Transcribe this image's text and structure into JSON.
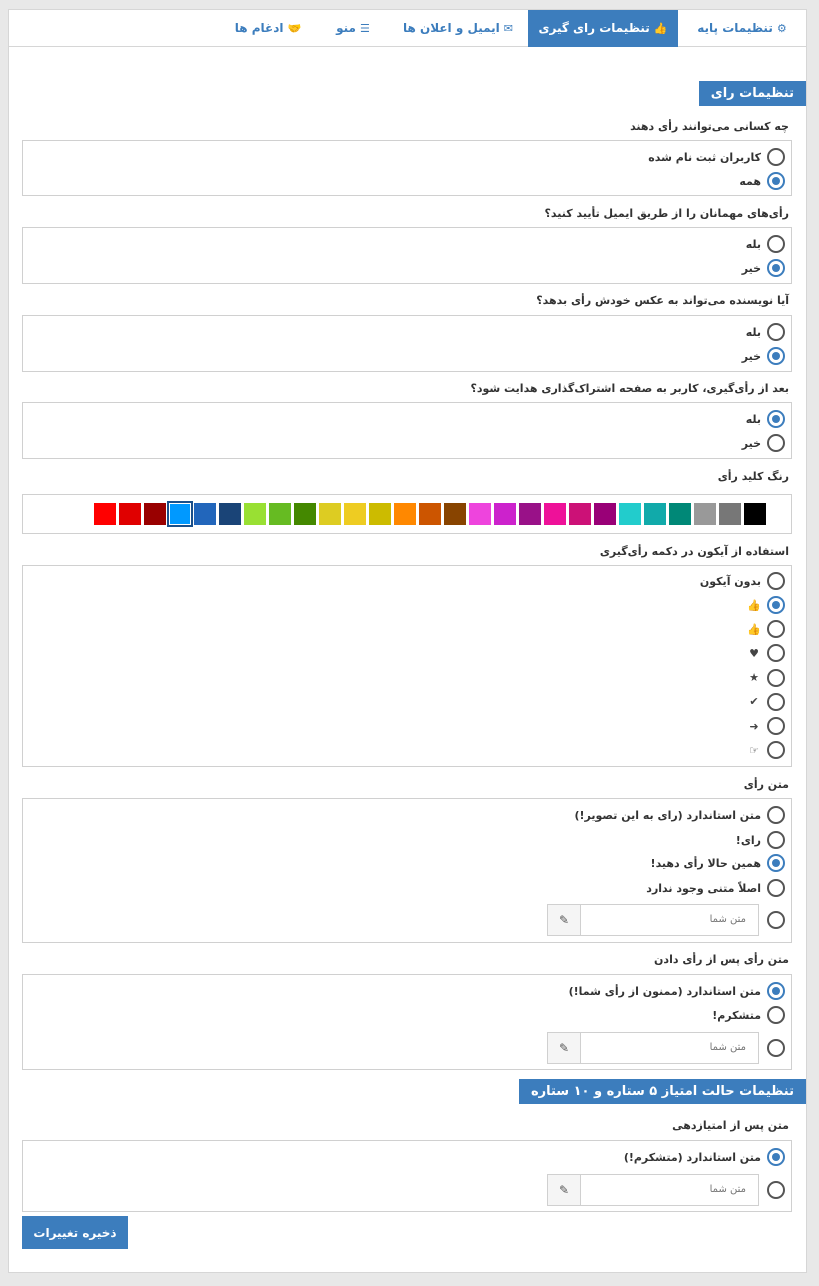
{
  "tabs": [
    {
      "label": "تنظیمات پایه",
      "icon": "gears-icon",
      "glyph": "⚙"
    },
    {
      "label": "تنظیمات رای گیری",
      "icon": "thumbs-up-icon",
      "glyph": "👍"
    },
    {
      "label": "ایمیل و اعلان ها",
      "icon": "envelope-icon",
      "glyph": "✉"
    },
    {
      "label": "منو",
      "icon": "bars-icon",
      "glyph": "☰"
    },
    {
      "label": "ادغام ها",
      "icon": "handshake-icon",
      "glyph": "🤝"
    }
  ],
  "section1": {
    "title": "تنظیمات رای"
  },
  "q_who": {
    "label": "چه کسانی می‌توانند رأی دهند",
    "options": [
      "کاربران ثبت نام شده",
      "همه"
    ]
  },
  "q_guest": {
    "label": "رأی‌های مهمانان را از طریق ایمیل تأیید کنید؟",
    "options": [
      "بله",
      "خیر"
    ]
  },
  "q_author": {
    "label": "آیا نویسنده می‌تواند به عکس خودش رأی بدهد؟",
    "options": [
      "بله",
      "خیر"
    ]
  },
  "q_redirect": {
    "label": "بعد از رأی‌گیری، کاربر به صفحه اشتراک‌گذاری هدایت شود؟",
    "options": [
      "بله",
      "خیر"
    ]
  },
  "q_color": {
    "label": "رنگ کلید رأی",
    "colors": [
      "#ff0000",
      "#e00000",
      "#990000",
      "#0099ff",
      "#2266bb",
      "#1a4477",
      "#99e033",
      "#66bb22",
      "#448800",
      "#ddcc22",
      "#eecc22",
      "#ccbb00",
      "#ff8800",
      "#cc5500",
      "#884400",
      "#ee44dd",
      "#cc22cc",
      "#991188",
      "#ee1199",
      "#cc1177",
      "#990077",
      "#22cccc",
      "#11aaaa",
      "#008877",
      "#999999",
      "#777777",
      "#000000"
    ],
    "selected": "#0099ff"
  },
  "q_icon": {
    "label": "استفاده از آیکون در دکمه رأی‌گیری",
    "none_label": "بدون آیکون",
    "icons": [
      {
        "name": "thumbs-up-solid-icon",
        "glyph": "👍"
      },
      {
        "name": "thumbs-up-outline-icon",
        "glyph": "👍"
      },
      {
        "name": "heart-icon",
        "glyph": "♥"
      },
      {
        "name": "star-icon",
        "glyph": "★"
      },
      {
        "name": "check-icon",
        "glyph": "✔"
      },
      {
        "name": "arrow-circle-icon",
        "glyph": "➜"
      },
      {
        "name": "hand-pointer-icon",
        "glyph": "☞"
      }
    ]
  },
  "q_vote_text": {
    "label": "متن رأی",
    "options": [
      "متن استاندارد (رای به این تصویر!)",
      "رای!",
      "همین حالا رأی دهید!",
      "اصلاً متنی وجود ندارد"
    ],
    "custom_placeholder": "متن شما"
  },
  "q_after_text": {
    "label": "متن رأی پس از رأی دادن",
    "options": [
      "متن استاندارد (ممنون از رأی شما!)",
      "متشکرم!"
    ],
    "custom_placeholder": "متن شما"
  },
  "section2": {
    "title": "تنظیمات حالت امتیاز ۵ ستاره و ۱۰ ستاره"
  },
  "q_rating_text": {
    "label": "متن پس از امتیازدهی",
    "options": [
      "متن استاندارد (متشکرم!)"
    ],
    "custom_placeholder": "متن شما"
  },
  "save_label": "ذخیره تغییرات"
}
